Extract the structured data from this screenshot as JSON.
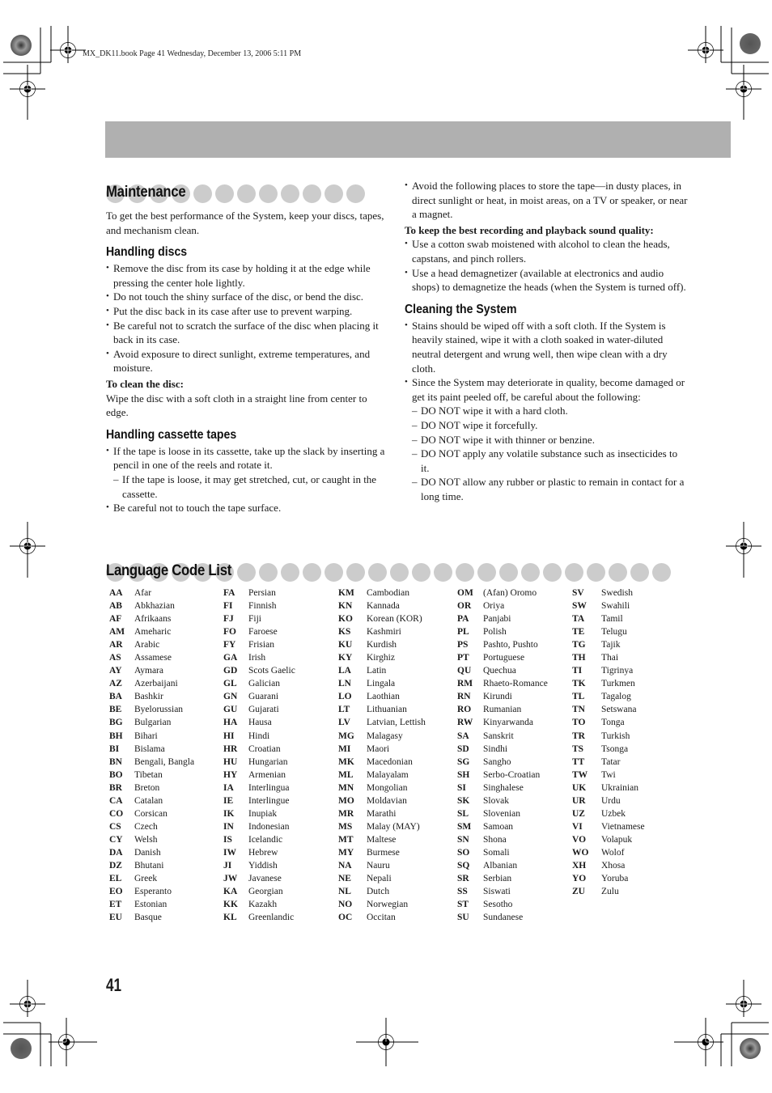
{
  "header": {
    "book_line": "MX_DK11.book  Page 41  Wednesday, December 13, 2006  5:11 PM"
  },
  "maintenance": {
    "title": "Maintenance",
    "intro": "To get the best performance of the System, keep your discs, tapes, and mechanism clean.",
    "handling_discs": {
      "title": "Handling discs",
      "bullets": [
        "Remove the disc from its case by holding it at the edge while pressing the center hole lightly.",
        "Do not touch the shiny surface of the disc, or bend the disc.",
        "Put the disc back in its case after use to prevent warping.",
        "Be careful not to scratch the surface of the disc when placing it back in its case.",
        "Avoid exposure to direct sunlight, extreme temperatures, and moisture."
      ],
      "clean_heading": "To clean the disc:",
      "clean_text": "Wipe the disc with a soft cloth in a straight line from center to edge."
    },
    "handling_tapes": {
      "title": "Handling cassette tapes",
      "bullet1": "If the tape is loose in its cassette, take up the slack by inserting a pencil in one of the reels and rotate it.",
      "dash1": "If the tape is loose, it may get stretched, cut, or caught in the cassette.",
      "bullet2": "Be careful not to touch the tape surface.",
      "bullet3": "Avoid the following places to store the tape—in dusty places, in direct sunlight or heat, in moist areas, on a TV or speaker, or near a magnet.",
      "quality_heading": "To keep the best recording and playback sound quality:",
      "quality_bullets": [
        "Use a cotton swab moistened with alcohol to clean the heads, capstans, and pinch rollers.",
        "Use a head demagnetizer (available at electronics and audio shops) to demagnetize the heads (when the System is turned off)."
      ]
    },
    "cleaning_system": {
      "title": "Cleaning the System",
      "bullet1": "Stains should be wiped off with a soft cloth. If the System is heavily stained, wipe it with a cloth soaked in water-diluted neutral detergent and wrung well, then wipe clean with a dry cloth.",
      "bullet2": "Since the System may deteriorate in quality, become damaged or get its paint peeled off, be careful about the following:",
      "dashes": [
        "DO NOT wipe it with a hard cloth.",
        "DO NOT wipe it forcefully.",
        "DO NOT wipe it with thinner or benzine.",
        "DO NOT apply any volatile substance such as insecticides to it.",
        "DO NOT allow any rubber or plastic to remain in contact for a long time."
      ]
    }
  },
  "language_codes": {
    "title": "Language Code List",
    "columns": [
      [
        {
          "code": "AA",
          "name": "Afar"
        },
        {
          "code": "AB",
          "name": "Abkhazian"
        },
        {
          "code": "AF",
          "name": "Afrikaans"
        },
        {
          "code": "AM",
          "name": "Ameharic"
        },
        {
          "code": "AR",
          "name": "Arabic"
        },
        {
          "code": "AS",
          "name": "Assamese"
        },
        {
          "code": "AY",
          "name": "Aymara"
        },
        {
          "code": "AZ",
          "name": "Azerbaijani"
        },
        {
          "code": "BA",
          "name": "Bashkir"
        },
        {
          "code": "BE",
          "name": "Byelorussian"
        },
        {
          "code": "BG",
          "name": "Bulgarian"
        },
        {
          "code": "BH",
          "name": "Bihari"
        },
        {
          "code": "BI",
          "name": "Bislama"
        },
        {
          "code": "BN",
          "name": "Bengali, Bangla"
        },
        {
          "code": "BO",
          "name": "Tibetan"
        },
        {
          "code": "BR",
          "name": "Breton"
        },
        {
          "code": "CA",
          "name": "Catalan"
        },
        {
          "code": "CO",
          "name": "Corsican"
        },
        {
          "code": "CS",
          "name": "Czech"
        },
        {
          "code": "CY",
          "name": "Welsh"
        },
        {
          "code": "DA",
          "name": "Danish"
        },
        {
          "code": "DZ",
          "name": "Bhutani"
        },
        {
          "code": "EL",
          "name": "Greek"
        },
        {
          "code": "EO",
          "name": "Esperanto"
        },
        {
          "code": "ET",
          "name": "Estonian"
        },
        {
          "code": "EU",
          "name": "Basque"
        }
      ],
      [
        {
          "code": "FA",
          "name": "Persian"
        },
        {
          "code": "FI",
          "name": "Finnish"
        },
        {
          "code": "FJ",
          "name": "Fiji"
        },
        {
          "code": "FO",
          "name": "Faroese"
        },
        {
          "code": "FY",
          "name": "Frisian"
        },
        {
          "code": "GA",
          "name": "Irish"
        },
        {
          "code": "GD",
          "name": "Scots Gaelic"
        },
        {
          "code": "GL",
          "name": "Galician"
        },
        {
          "code": "GN",
          "name": "Guarani"
        },
        {
          "code": "GU",
          "name": "Gujarati"
        },
        {
          "code": "HA",
          "name": "Hausa"
        },
        {
          "code": "HI",
          "name": "Hindi"
        },
        {
          "code": "HR",
          "name": "Croatian"
        },
        {
          "code": "HU",
          "name": "Hungarian"
        },
        {
          "code": "HY",
          "name": "Armenian"
        },
        {
          "code": "IA",
          "name": "Interlingua"
        },
        {
          "code": "IE",
          "name": "Interlingue"
        },
        {
          "code": "IK",
          "name": "Inupiak"
        },
        {
          "code": "IN",
          "name": "Indonesian"
        },
        {
          "code": "IS",
          "name": "Icelandic"
        },
        {
          "code": "IW",
          "name": "Hebrew"
        },
        {
          "code": "JI",
          "name": "Yiddish"
        },
        {
          "code": "JW",
          "name": "Javanese"
        },
        {
          "code": "KA",
          "name": "Georgian"
        },
        {
          "code": "KK",
          "name": "Kazakh"
        },
        {
          "code": "KL",
          "name": "Greenlandic"
        }
      ],
      [
        {
          "code": "KM",
          "name": "Cambodian"
        },
        {
          "code": "KN",
          "name": "Kannada"
        },
        {
          "code": "KO",
          "name": "Korean (KOR)"
        },
        {
          "code": "KS",
          "name": "Kashmiri"
        },
        {
          "code": "KU",
          "name": "Kurdish"
        },
        {
          "code": "KY",
          "name": "Kirghiz"
        },
        {
          "code": "LA",
          "name": "Latin"
        },
        {
          "code": "LN",
          "name": "Lingala"
        },
        {
          "code": "LO",
          "name": "Laothian"
        },
        {
          "code": "LT",
          "name": "Lithuanian"
        },
        {
          "code": "LV",
          "name": "Latvian, Lettish"
        },
        {
          "code": "MG",
          "name": "Malagasy"
        },
        {
          "code": "MI",
          "name": "Maori"
        },
        {
          "code": "MK",
          "name": "Macedonian"
        },
        {
          "code": "ML",
          "name": "Malayalam"
        },
        {
          "code": "MN",
          "name": "Mongolian"
        },
        {
          "code": "MO",
          "name": "Moldavian"
        },
        {
          "code": "MR",
          "name": "Marathi"
        },
        {
          "code": "MS",
          "name": "Malay (MAY)"
        },
        {
          "code": "MT",
          "name": "Maltese"
        },
        {
          "code": "MY",
          "name": "Burmese"
        },
        {
          "code": "NA",
          "name": "Nauru"
        },
        {
          "code": "NE",
          "name": "Nepali"
        },
        {
          "code": "NL",
          "name": "Dutch"
        },
        {
          "code": "NO",
          "name": "Norwegian"
        },
        {
          "code": "OC",
          "name": "Occitan"
        }
      ],
      [
        {
          "code": "OM",
          "name": "(Afan) Oromo"
        },
        {
          "code": "OR",
          "name": "Oriya"
        },
        {
          "code": "PA",
          "name": "Panjabi"
        },
        {
          "code": "PL",
          "name": "Polish"
        },
        {
          "code": "PS",
          "name": "Pashto, Pushto"
        },
        {
          "code": "PT",
          "name": "Portuguese"
        },
        {
          "code": "QU",
          "name": "Quechua"
        },
        {
          "code": "RM",
          "name": "Rhaeto-Romance"
        },
        {
          "code": "RN",
          "name": "Kirundi"
        },
        {
          "code": "RO",
          "name": "Rumanian"
        },
        {
          "code": "RW",
          "name": "Kinyarwanda"
        },
        {
          "code": "SA",
          "name": "Sanskrit"
        },
        {
          "code": "SD",
          "name": "Sindhi"
        },
        {
          "code": "SG",
          "name": "Sangho"
        },
        {
          "code": "SH",
          "name": "Serbo-Croatian"
        },
        {
          "code": "SI",
          "name": "Singhalese"
        },
        {
          "code": "SK",
          "name": "Slovak"
        },
        {
          "code": "SL",
          "name": "Slovenian"
        },
        {
          "code": "SM",
          "name": "Samoan"
        },
        {
          "code": "SN",
          "name": "Shona"
        },
        {
          "code": "SO",
          "name": "Somali"
        },
        {
          "code": "SQ",
          "name": "Albanian"
        },
        {
          "code": "SR",
          "name": "Serbian"
        },
        {
          "code": "SS",
          "name": "Siswati"
        },
        {
          "code": "ST",
          "name": "Sesotho"
        },
        {
          "code": "SU",
          "name": "Sundanese"
        }
      ],
      [
        {
          "code": "SV",
          "name": "Swedish"
        },
        {
          "code": "SW",
          "name": "Swahili"
        },
        {
          "code": "TA",
          "name": "Tamil"
        },
        {
          "code": "TE",
          "name": "Telugu"
        },
        {
          "code": "TG",
          "name": "Tajik"
        },
        {
          "code": "TH",
          "name": "Thai"
        },
        {
          "code": "TI",
          "name": "Tigrinya"
        },
        {
          "code": "TK",
          "name": "Turkmen"
        },
        {
          "code": "TL",
          "name": "Tagalog"
        },
        {
          "code": "TN",
          "name": "Setswana"
        },
        {
          "code": "TO",
          "name": "Tonga"
        },
        {
          "code": "TR",
          "name": "Turkish"
        },
        {
          "code": "TS",
          "name": "Tsonga"
        },
        {
          "code": "TT",
          "name": "Tatar"
        },
        {
          "code": "TW",
          "name": "Twi"
        },
        {
          "code": "UK",
          "name": "Ukrainian"
        },
        {
          "code": "UR",
          "name": "Urdu"
        },
        {
          "code": "UZ",
          "name": "Uzbek"
        },
        {
          "code": "VI",
          "name": "Vietnamese"
        },
        {
          "code": "VO",
          "name": "Volapuk"
        },
        {
          "code": "WO",
          "name": "Wolof"
        },
        {
          "code": "XH",
          "name": "Xhosa"
        },
        {
          "code": "YO",
          "name": "Yoruba"
        },
        {
          "code": "ZU",
          "name": "Zulu"
        }
      ]
    ]
  },
  "footer": {
    "page_number": "41"
  }
}
